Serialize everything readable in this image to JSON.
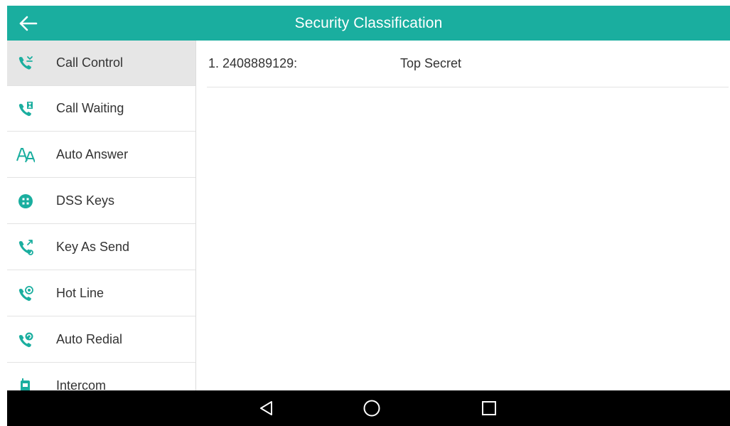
{
  "header": {
    "title": "Security Classification",
    "back_icon": "arrow-left-icon"
  },
  "sidebar": {
    "items": [
      {
        "label": "Call Control",
        "icon": "call-control-icon",
        "active": true
      },
      {
        "label": "Call Waiting",
        "icon": "call-waiting-icon",
        "active": false
      },
      {
        "label": "Auto Answer",
        "icon": "auto-answer-icon",
        "active": false
      },
      {
        "label": "DSS Keys",
        "icon": "dss-keys-icon",
        "active": false
      },
      {
        "label": "Key As Send",
        "icon": "key-as-send-icon",
        "active": false
      },
      {
        "label": "Hot Line",
        "icon": "hot-line-icon",
        "active": false
      },
      {
        "label": "Auto Redial",
        "icon": "auto-redial-icon",
        "active": false
      },
      {
        "label": "Intercom",
        "icon": "intercom-icon",
        "active": false
      }
    ]
  },
  "main": {
    "rows": [
      {
        "label": "1. 2408889129:",
        "value": "Top Secret"
      }
    ]
  },
  "navbar": {
    "back_icon": "triangle-back-icon",
    "home_icon": "circle-home-icon",
    "recents_icon": "square-recents-icon"
  },
  "colors": {
    "accent": "#1aae9f",
    "sidebar_active": "#e6e6e6",
    "navbar": "#000000"
  }
}
